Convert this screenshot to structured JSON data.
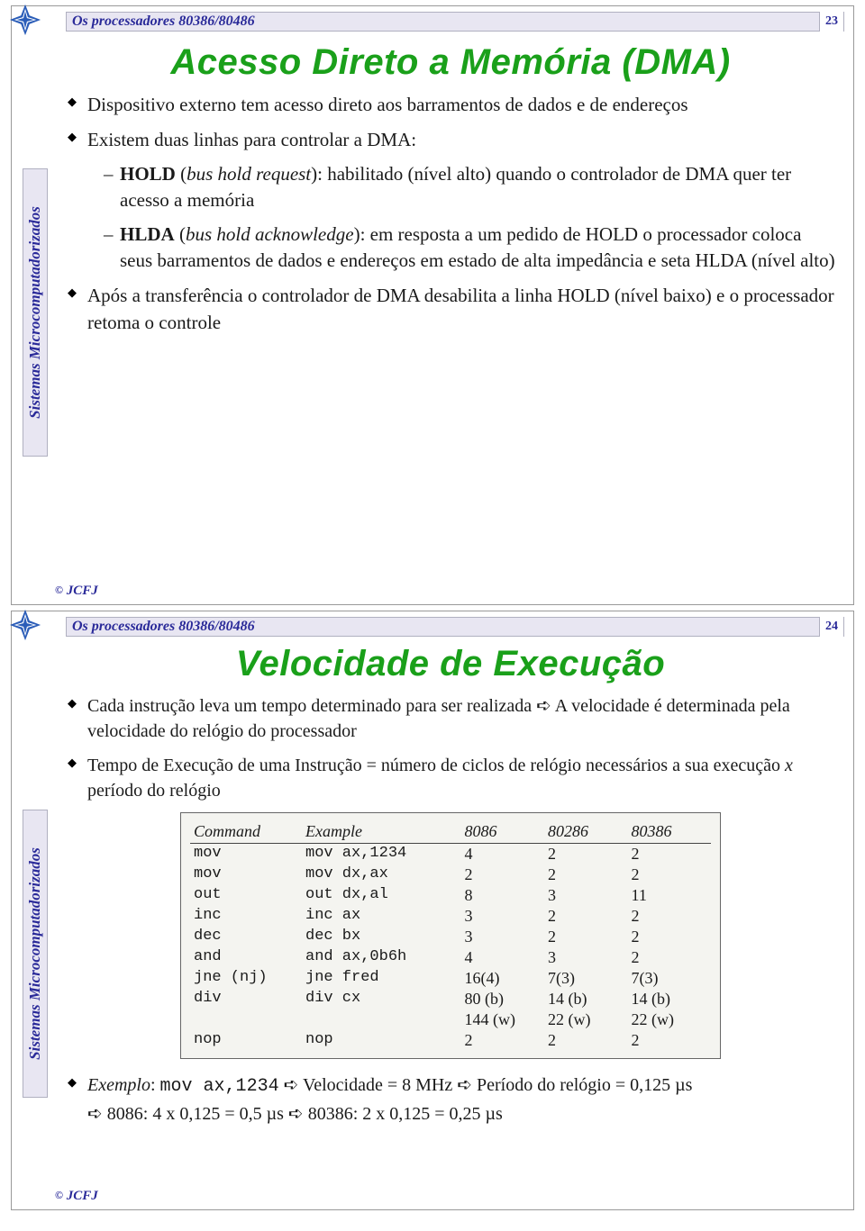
{
  "common": {
    "header_title": "Os processadores 80386/80486",
    "side_label": "Sistemas Microcomputadorizados",
    "footer": "JCFJ",
    "copyright": "©"
  },
  "slide23": {
    "page": "23",
    "title": "Acesso Direto a Memória (DMA)",
    "b1": "Dispositivo externo tem acesso direto aos barramentos de dados e de endereços",
    "b2": "Existem duas linhas para controlar a DMA:",
    "b2a_prefix": "HOLD",
    "b2a_paren": " (",
    "b2a_italic": "bus hold request",
    "b2a_rest": "): habilitado (nível alto) quando o controlador de DMA quer ter acesso a memória",
    "b2b_prefix": "HLDA",
    "b2b_paren": " (",
    "b2b_italic": "bus hold acknowledge",
    "b2b_rest": "): em resposta a um pedido de HOLD o processador coloca seus barramentos de dados e endereços em estado de alta impedância e seta HLDA (nível alto)",
    "b3": "Após a transferência o controlador de DMA desabilita a linha HOLD (nível baixo) e o processador retoma o controle"
  },
  "slide24": {
    "page": "24",
    "title": "Velocidade de Execução",
    "b1_a": "Cada instrução leva um tempo determinado para ser realizada ",
    "b1_arrow": "➪",
    "b1_b": " A velocidade é determinada pela velocidade do relógio do processador",
    "b2_a": "Tempo de Execução de uma Instrução = número de ciclos de relógio necessários a sua execução ",
    "b2_x": "x",
    "b2_b": " período do relógio",
    "table": {
      "headers": [
        "Command",
        "Example",
        "8086",
        "80286",
        "80386"
      ],
      "rows": [
        {
          "cmd": "mov",
          "ex": "mov ax,1234",
          "c86": "4",
          "c286": "2",
          "c386": "2",
          "extra86": "",
          "extra286": "",
          "extra386": ""
        },
        {
          "cmd": "mov",
          "ex": "mov dx,ax",
          "c86": "2",
          "c286": "2",
          "c386": "2",
          "extra86": "",
          "extra286": "",
          "extra386": ""
        },
        {
          "cmd": "out",
          "ex": "out dx,al",
          "c86": "8",
          "c286": "3",
          "c386": "11",
          "extra86": "",
          "extra286": "",
          "extra386": ""
        },
        {
          "cmd": "inc",
          "ex": "inc ax",
          "c86": "3",
          "c286": "2",
          "c386": "2",
          "extra86": "",
          "extra286": "",
          "extra386": ""
        },
        {
          "cmd": "dec",
          "ex": "dec bx",
          "c86": "3",
          "c286": "2",
          "c386": "2",
          "extra86": "",
          "extra286": "",
          "extra386": ""
        },
        {
          "cmd": "and",
          "ex": "and ax,0b6h",
          "c86": "4",
          "c286": "3",
          "c386": "2",
          "extra86": "",
          "extra286": "",
          "extra386": ""
        },
        {
          "cmd": "jne (nj)",
          "ex": "jne fred",
          "c86": "16(4)",
          "c286": "7(3)",
          "c386": "7(3)",
          "extra86": "",
          "extra286": "",
          "extra386": ""
        },
        {
          "cmd": "div",
          "ex": "div cx",
          "c86": "80 (b)",
          "c286": "14 (b)",
          "c386": "14 (b)",
          "extra86": "144 (w)",
          "extra286": "22 (w)",
          "extra386": "22 (w)"
        },
        {
          "cmd": "nop",
          "ex": "nop",
          "c86": "2",
          "c286": "2",
          "c386": "2",
          "extra86": "",
          "extra286": "",
          "extra386": ""
        }
      ]
    },
    "ex_label": "Exemplo",
    "ex_code": "mov ax,1234",
    "ex_a": " Velocidade = 8 MHz ",
    "ex_b": " Período do relógio = 0,125 µs",
    "ex_line2_a": " 8086: 4 x 0,125 = 0,5 µs ",
    "ex_line2_b": " 80386: 2 x 0,125 = 0,25 µs"
  },
  "chart_data": {
    "type": "table",
    "title": "Instruction clock cycles by processor",
    "columns": [
      "Command",
      "Example",
      "8086",
      "80286",
      "80386"
    ],
    "rows": [
      [
        "mov",
        "mov ax,1234",
        "4",
        "2",
        "2"
      ],
      [
        "mov",
        "mov dx,ax",
        "2",
        "2",
        "2"
      ],
      [
        "out",
        "out dx,al",
        "8",
        "3",
        "11"
      ],
      [
        "inc",
        "inc ax",
        "3",
        "2",
        "2"
      ],
      [
        "dec",
        "dec bx",
        "3",
        "2",
        "2"
      ],
      [
        "and",
        "and ax,0b6h",
        "4",
        "3",
        "2"
      ],
      [
        "jne (nj)",
        "jne fred",
        "16(4)",
        "7(3)",
        "7(3)"
      ],
      [
        "div",
        "div cx",
        "80 (b) / 144 (w)",
        "14 (b) / 22 (w)",
        "14 (b) / 22 (w)"
      ],
      [
        "nop",
        "nop",
        "2",
        "2",
        "2"
      ]
    ]
  }
}
